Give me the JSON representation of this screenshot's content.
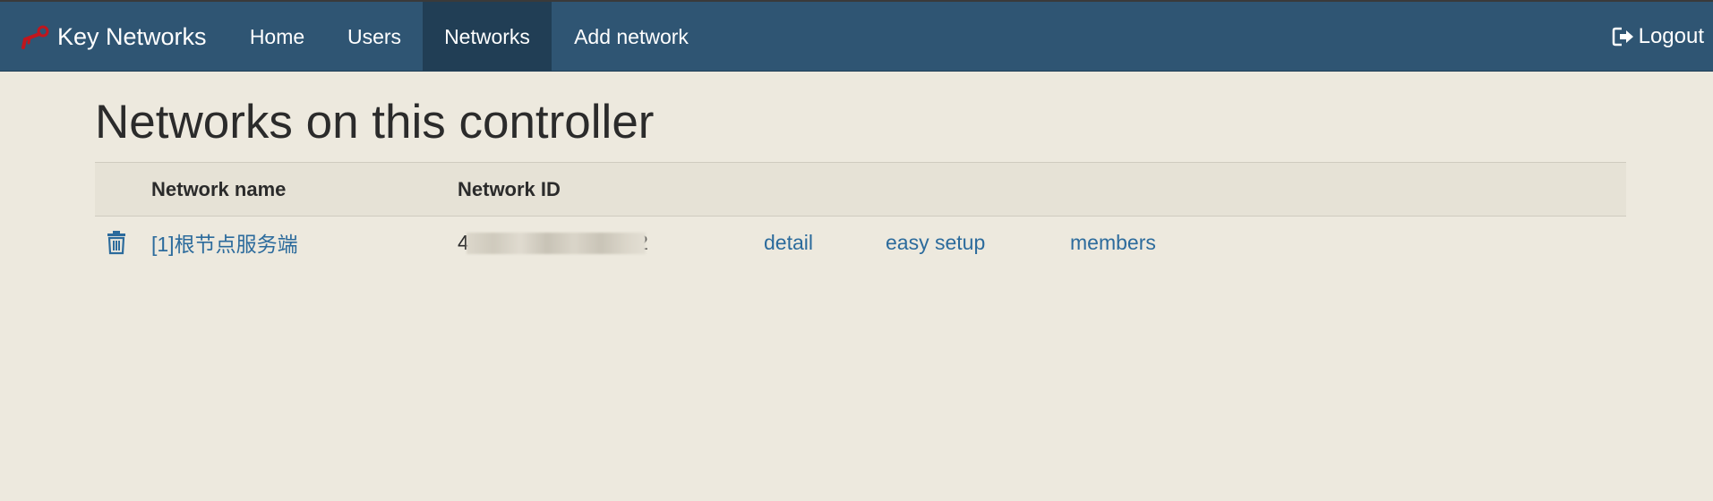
{
  "navbar": {
    "brand": "Key Networks",
    "items": [
      {
        "label": "Home",
        "active": false
      },
      {
        "label": "Users",
        "active": false
      },
      {
        "label": "Networks",
        "active": true
      },
      {
        "label": "Add network",
        "active": false
      }
    ],
    "logout_label": "Logout",
    "brand_icon": "key-icon",
    "logout_icon": "logout-icon"
  },
  "page": {
    "title": "Networks on this controller"
  },
  "table": {
    "headers": [
      "",
      "Network name",
      "Network ID",
      "",
      "",
      ""
    ],
    "rows": [
      {
        "delete_icon": "trash-icon",
        "name": "[1]根节点服务端",
        "id_prefix": "4",
        "id_suffix": "2",
        "id_redacted": true,
        "actions": [
          "detail",
          "easy setup",
          "members"
        ]
      }
    ]
  },
  "colors": {
    "navbar_bg": "#2f5573",
    "navbar_active": "#213e55",
    "page_bg": "#ede9de",
    "link": "#2c6b9c",
    "brand_icon": "#c0161d"
  }
}
